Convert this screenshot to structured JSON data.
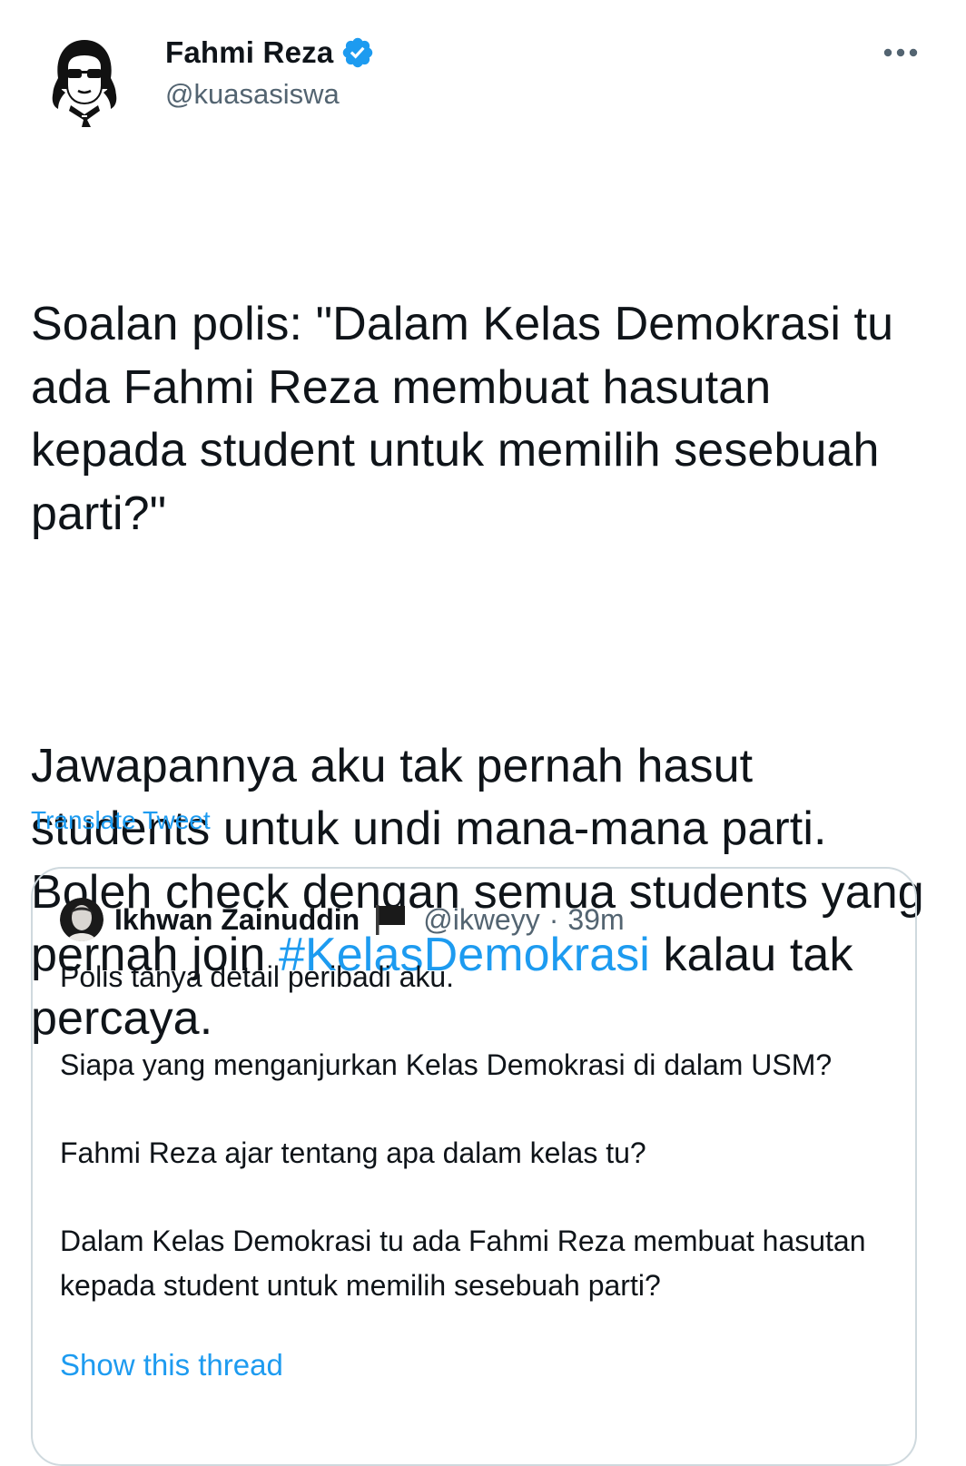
{
  "author": {
    "display_name": "Fahmi Reza",
    "handle": "@kuasasiswa",
    "verified": true,
    "avatar_icon": "illustrated-portrait-avatar",
    "verified_color": "#1d9bf0"
  },
  "more_icon": "more-options-icon",
  "tweet": {
    "paragraph_1": "Soalan polis: \"Dalam Kelas Demokrasi tu ada Fahmi Reza membuat hasutan kepada student untuk memilih sesebuah parti?\"",
    "paragraph_2_before": "Jawapannya aku tak pernah hasut students untuk undi mana-mana parti. Boleh check dengan semua students yang pernah join ",
    "hashtag": "#KelasDemokrasi",
    "paragraph_2_after": " kalau tak percaya."
  },
  "translate_label": "Translate Tweet",
  "quoted_tweet": {
    "display_name": "Ikhwan Zainuddin",
    "flag_icon": "black-flag-icon",
    "handle": "@ikweyy",
    "separator": "·",
    "time": "39m",
    "paragraphs": [
      "Polis tanya detail peribadi aku.",
      "Siapa yang menganjurkan Kelas Demokrasi di dalam USM?",
      "Fahmi Reza ajar tentang apa dalam kelas tu?",
      "Dalam Kelas Demokrasi tu ada Fahmi Reza membuat hasutan kepada student untuk memilih sesebuah parti?"
    ],
    "show_thread_label": "Show this thread"
  },
  "colors": {
    "text": "#0f1419",
    "secondary": "#536471",
    "link": "#1d9bf0",
    "border": "#cfd9de"
  }
}
